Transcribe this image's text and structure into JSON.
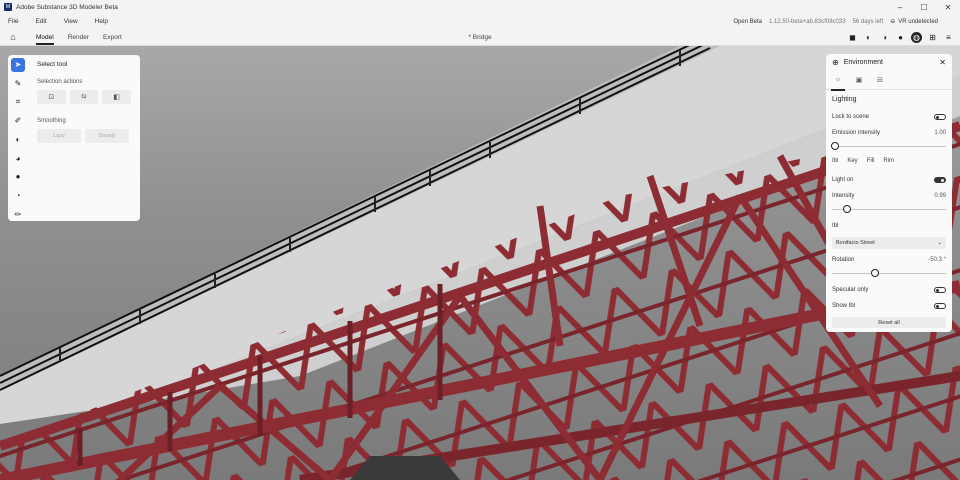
{
  "window": {
    "title": "Adobe Substance 3D Modeler Beta",
    "app_icon": "M",
    "minimize": "–",
    "maximize": "☐",
    "close": "✕"
  },
  "menu": {
    "items": [
      "File",
      "Edit",
      "View",
      "Help"
    ],
    "build_channel": "Open Beta",
    "version": "1.12.50-beta+ab.83cf08c033",
    "days_left": "56 days left",
    "vr_status": "VR undetected"
  },
  "toolbar": {
    "tabs": [
      "Model",
      "Render",
      "Export"
    ],
    "active_tab": "Model",
    "document_title": "* Bridge"
  },
  "tool_strip": {
    "tools": [
      "select-tool",
      "brush-tool",
      "crop-tool",
      "paint-tool",
      "sphere-tool",
      "shape-tool",
      "blob-tool",
      "shaded-tool",
      "pencil-tool"
    ]
  },
  "select_panel": {
    "title": "Select tool",
    "selection_actions_label": "Selection actions",
    "smoothing_label": "Smoothing",
    "smoothing_buttons": [
      "Lazy",
      "Steady"
    ]
  },
  "environment": {
    "title": "Environment",
    "section": "Lighting",
    "lock_to_scene_label": "Lock to scene",
    "lock_to_scene": false,
    "emission_intensity_label": "Emission intensity",
    "emission_intensity_value": "1.00",
    "emission_intensity_fraction": 0.03,
    "subtabs": [
      "Ibl",
      "Key",
      "Fill",
      "Rim"
    ],
    "light_on_label": "Light on",
    "light_on": true,
    "intensity_label": "Intensity",
    "intensity_value": "0.99",
    "intensity_fraction": 0.13,
    "ibl_label": "Ibl",
    "ibl_selected": "Bonifacio Street",
    "rotation_label": "Rotation",
    "rotation_value": "-50.3 °",
    "rotation_fraction": 0.38,
    "specular_only_label": "Specular only",
    "specular_only": false,
    "show_ibl_label": "Show Ibl",
    "show_ibl": false,
    "reset_label": "Reset all"
  },
  "colors": {
    "truss": "#8e2c33",
    "truss_dark": "#5e1b21",
    "deck": "#e0e0e0",
    "accent": "#3b73e0"
  }
}
